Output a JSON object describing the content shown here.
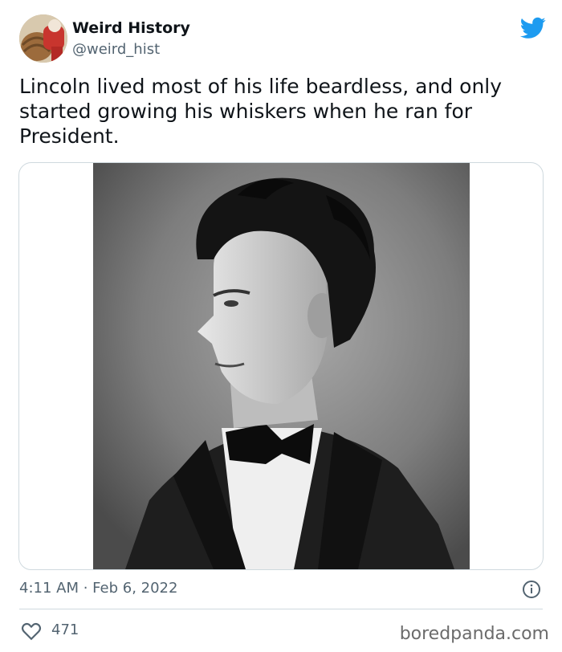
{
  "tweet": {
    "display_name": "Weird History",
    "handle": "@weird_hist",
    "text": "Lincoln lived most of his life beardless, and only started growing his whiskers when he ran for President.",
    "timestamp": "4:11 AM · Feb 6, 2022",
    "likes": "471",
    "avatar_icon": "avatar-image",
    "platform_icon": "twitter-bird-icon",
    "brand_color": "#1d9bf0"
  },
  "watermark": "boredpanda.com",
  "media": {
    "description_icon": "portrait-photo"
  }
}
